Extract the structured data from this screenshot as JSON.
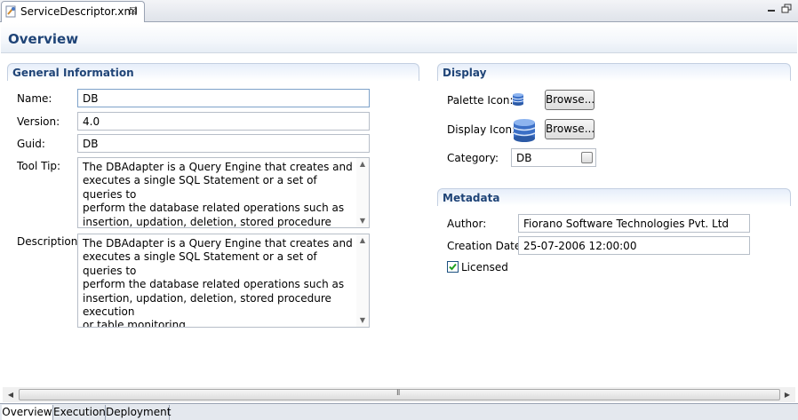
{
  "editor_tab": {
    "title": "ServiceDescriptor.xml"
  },
  "form": {
    "title": "Overview"
  },
  "general": {
    "title": "General Information",
    "name_label": "Name:",
    "name_value": "DB",
    "version_label": "Version:",
    "version_value": "4.0",
    "guid_label": "Guid:",
    "guid_value": "DB",
    "tooltip_label": "Tool Tip:",
    "tooltip_value": "The DBAdapter is a Query Engine that creates and\nexecutes a single SQL Statement or a set of queries to\nperform the database related operations such as\ninsertion, updation, deletion, stored procedure execution\nor table monitoring",
    "description_label": "Description:",
    "description_value": "The DBAdapter is a Query Engine that creates and\nexecutes a single SQL Statement or a set of queries to\nperform the database related operations such as\ninsertion, updation, deletion, stored procedure execution\nor table monitoring"
  },
  "display": {
    "title": "Display",
    "palette_icon_label": "Palette Icon:",
    "display_icon_label": "Display Icon:",
    "browse_label": "Browse...",
    "category_label": "Category:",
    "category_value": "DB"
  },
  "metadata": {
    "title": "Metadata",
    "author_label": "Author:",
    "author_value": "Fiorano Software Technologies Pvt. Ltd",
    "creation_label": "Creation Date:",
    "creation_value": "25-07-2006 12:00:00",
    "licensed_label": "Licensed",
    "licensed_checked": true
  },
  "bottom_tabs": [
    {
      "label": "Overview",
      "active": true
    },
    {
      "label": "Execution",
      "active": false
    },
    {
      "label": "Deployment",
      "active": false
    }
  ],
  "icons": [
    "xml-file-icon",
    "close-icon",
    "minimize-icon",
    "maximize-icon",
    "database-icon",
    "checkbox-icon"
  ],
  "colors": {
    "section_title": "#1f4477",
    "tab_border": "#9aa3b3"
  }
}
